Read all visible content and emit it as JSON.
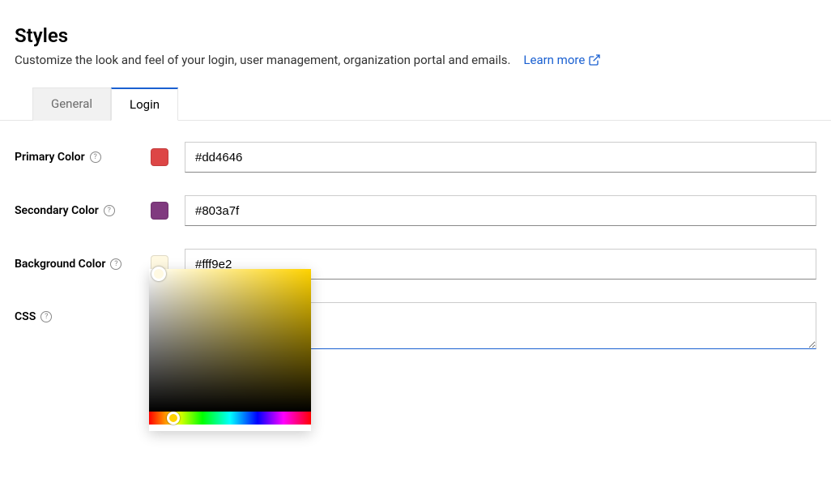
{
  "header": {
    "title": "Styles",
    "subtitle": "Customize the look and feel of your login, user management, organization portal and emails.",
    "learn_more": "Learn more"
  },
  "tabs": {
    "general": "General",
    "login": "Login",
    "active": "login"
  },
  "fields": {
    "primary": {
      "label": "Primary Color",
      "value": "#dd4646",
      "swatch": "#dd4646"
    },
    "secondary": {
      "label": "Secondary Color",
      "value": "#803a7f",
      "swatch": "#803a7f"
    },
    "background": {
      "label": "Background Color",
      "value": "#fff9e2",
      "swatch": "#fff9e2"
    },
    "css": {
      "label": "CSS",
      "value": ""
    }
  },
  "color_picker": {
    "open_for": "background",
    "hue_hex": "#ffd300",
    "selected_hex": "#fff9e2"
  }
}
